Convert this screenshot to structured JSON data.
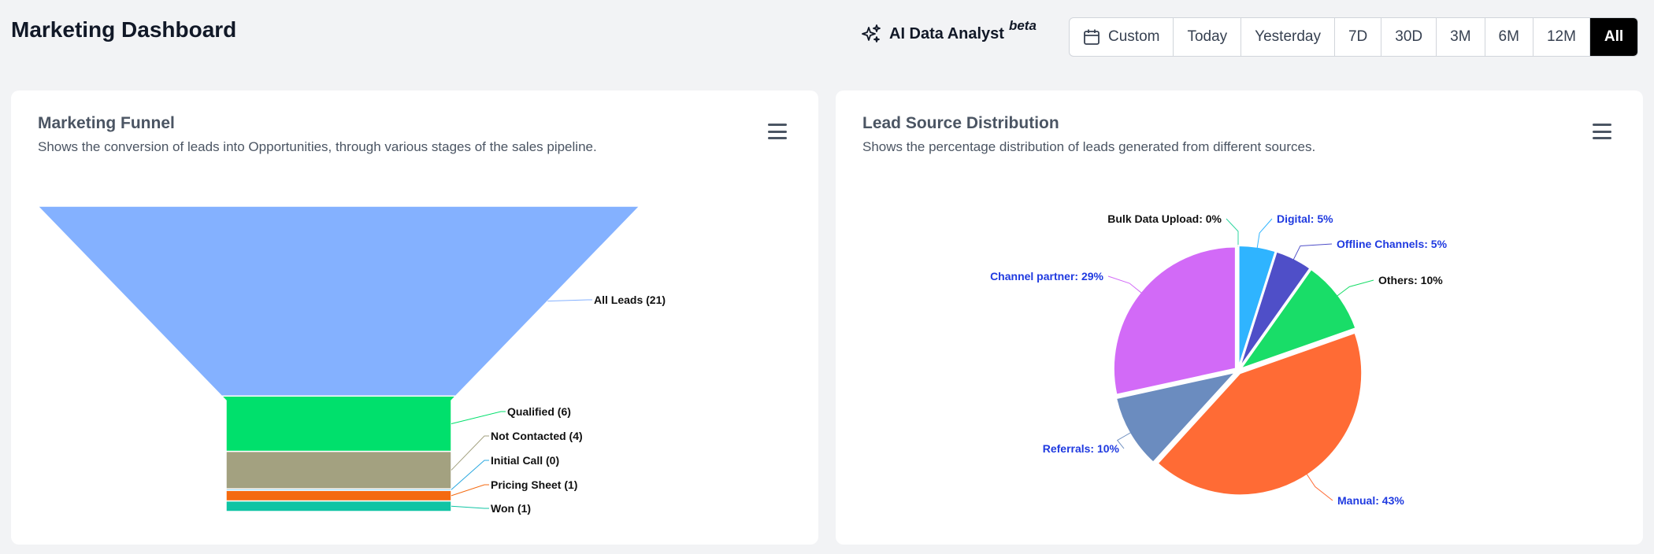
{
  "header": {
    "title": "Marketing Dashboard",
    "ai_label": "AI Data Analyst",
    "ai_badge": "beta",
    "ranges": [
      "Custom",
      "Today",
      "Yesterday",
      "7D",
      "30D",
      "3M",
      "6M",
      "12M",
      "All"
    ],
    "active_range": "All"
  },
  "funnel_card": {
    "title": "Marketing Funnel",
    "subtitle": "Shows the conversion of leads into Opportunities, through various stages of the sales pipeline."
  },
  "pie_card": {
    "title": "Lead Source Distribution",
    "subtitle": "Shows the percentage distribution of leads generated from different sources."
  },
  "chart_data": [
    {
      "type": "funnel",
      "stages": [
        {
          "label": "All Leads (21)",
          "name": "All Leads",
          "value": 21,
          "color": "#84b1ff"
        },
        {
          "label": "Qualified (6)",
          "name": "Qualified",
          "value": 6,
          "color": "#00e06c"
        },
        {
          "label": "Not Contacted (4)",
          "name": "Not Contacted",
          "value": 4,
          "color": "#a3a180"
        },
        {
          "label": "Initial Call (0)",
          "name": "Initial Call",
          "value": 0,
          "color": "#2aa8e0"
        },
        {
          "label": "Pricing Sheet (1)",
          "name": "Pricing Sheet",
          "value": 1,
          "color": "#f46a10"
        },
        {
          "label": "Won (1)",
          "name": "Won",
          "value": 1,
          "color": "#10c4a4"
        }
      ]
    },
    {
      "type": "pie",
      "slices": [
        {
          "name": "Bulk Data Upload",
          "value": 0,
          "label": "Bulk Data Upload: 0%",
          "color": "#2fd6a0",
          "label_color": "#111111"
        },
        {
          "name": "Digital",
          "value": 5,
          "label": "Digital: 5%",
          "color": "#2fb4ff",
          "label_color": "#1f3ae0"
        },
        {
          "name": "Offline Channels",
          "value": 5,
          "label": "Offline Channels: 5%",
          "color": "#4f4fc8",
          "label_color": "#1f3ae0"
        },
        {
          "name": "Others",
          "value": 10,
          "label": "Others: 10%",
          "color": "#19dd68",
          "label_color": "#111111"
        },
        {
          "name": "Manual",
          "value": 43,
          "label": "Manual: 43%",
          "color": "#ff6b35",
          "label_color": "#1f3ae0"
        },
        {
          "name": "Referrals",
          "value": 10,
          "label": "Referrals: 10%",
          "color": "#6b8cbf",
          "label_color": "#1f3ae0"
        },
        {
          "name": "Channel partner",
          "value": 29,
          "label": "Channel partner: 29%",
          "color": "#d26af7",
          "label_color": "#1f3ae0"
        }
      ]
    }
  ]
}
